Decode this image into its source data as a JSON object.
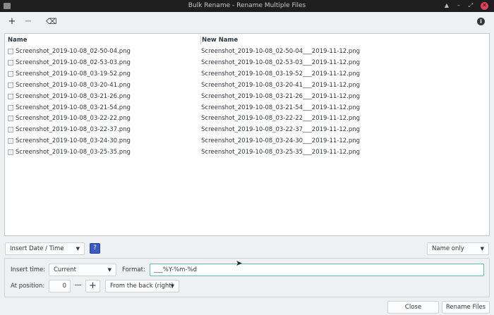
{
  "window": {
    "title": "Bulk Rename - Rename Multiple Files"
  },
  "toolbar": {
    "add": "+",
    "remove": "−",
    "clear": "⌫",
    "info": "i"
  },
  "list": {
    "headers": [
      "Name",
      "New Name"
    ],
    "rows": [
      {
        "name": "Screenshot_2019-10-08_02-50-04.png",
        "new": "Screenshot_2019-10-08_02-50-04___2019-11-12.png"
      },
      {
        "name": "Screenshot_2019-10-08_02-53-03.png",
        "new": "Screenshot_2019-10-08_02-53-03___2019-11-12.png"
      },
      {
        "name": "Screenshot_2019-10-08_03-19-52.png",
        "new": "Screenshot_2019-10-08_03-19-52___2019-11-12.png"
      },
      {
        "name": "Screenshot_2019-10-08_03-20-41.png",
        "new": "Screenshot_2019-10-08_03-20-41___2019-11-12.png"
      },
      {
        "name": "Screenshot_2019-10-08_03-21-26.png",
        "new": "Screenshot_2019-10-08_03-21-26___2019-11-12.png"
      },
      {
        "name": "Screenshot_2019-10-08_03-21-54.png",
        "new": "Screenshot_2019-10-08_03-21-54___2019-11-12.png"
      },
      {
        "name": "Screenshot_2019-10-08_03-22-22.png",
        "new": "Screenshot_2019-10-08_03-22-22___2019-11-12.png"
      },
      {
        "name": "Screenshot_2019-10-08_03-22-37.png",
        "new": "Screenshot_2019-10-08_03-22-37___2019-11-12.png"
      },
      {
        "name": "Screenshot_2019-10-08_03-24-30.png",
        "new": "Screenshot_2019-10-08_03-24-30___2019-11-12.png"
      },
      {
        "name": "Screenshot_2019-10-08_03-25-35.png",
        "new": "Screenshot_2019-10-08_03-25-35___2019-11-12.png"
      }
    ]
  },
  "controls": {
    "mode": "Insert Date / Time",
    "help": "?",
    "scope": "Name only",
    "insert_time_label": "Insert time:",
    "insert_time": "Current",
    "format_label": "Format:",
    "format": "___%Y-%m-%d",
    "position_label": "At position:",
    "position": "0",
    "minus": "—",
    "plus": "+",
    "direction": "From the back (right)"
  },
  "footer": {
    "close": "Close",
    "rename": "Rename Files"
  }
}
